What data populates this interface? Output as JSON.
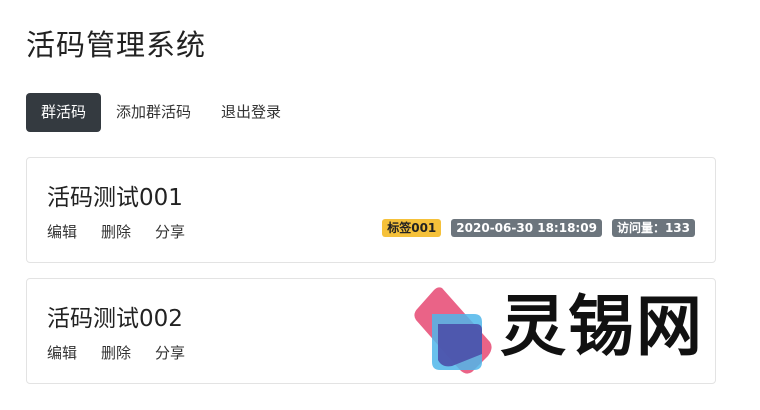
{
  "app": {
    "title": "活码管理系统"
  },
  "nav": {
    "items": [
      {
        "label": "群活码",
        "active": true
      },
      {
        "label": "添加群活码",
        "active": false
      },
      {
        "label": "退出登录",
        "active": false
      }
    ]
  },
  "cards": [
    {
      "title": "活码测试001",
      "actions": {
        "edit": "编辑",
        "delete": "删除",
        "share": "分享"
      },
      "tag": "标签001",
      "datetime": "2020-06-30 18:18:09",
      "visits": "访问量：133"
    },
    {
      "title": "活码测试002",
      "actions": {
        "edit": "编辑",
        "delete": "删除",
        "share": "分享"
      }
    }
  ],
  "watermark": {
    "text": "灵锡网"
  },
  "colors": {
    "nav_active_bg": "#343a40",
    "tag_badge": "#f5c13a",
    "info_badge": "#6c757d"
  }
}
